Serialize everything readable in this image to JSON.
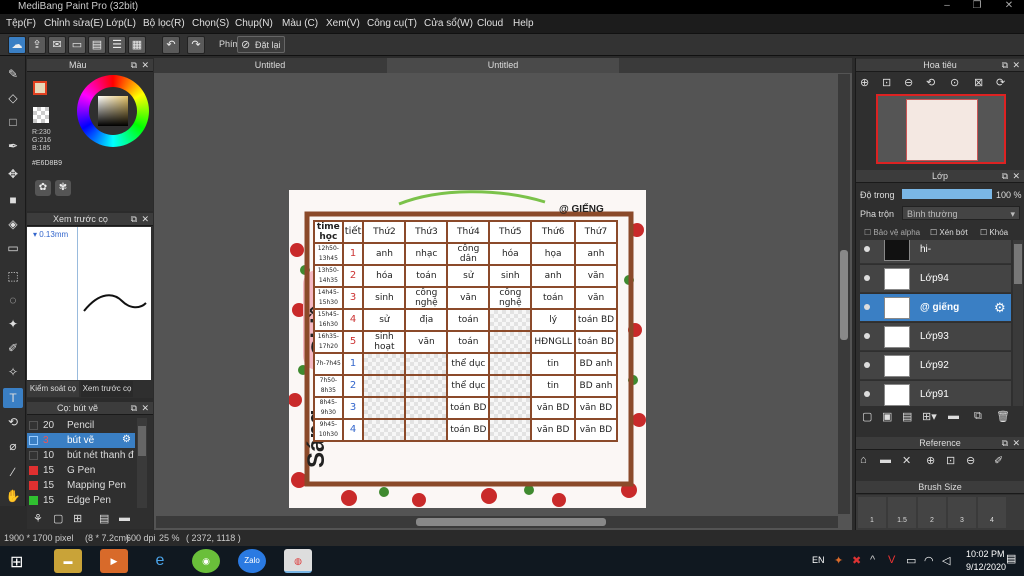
{
  "window": {
    "title": "MediBang Paint Pro (32bit)"
  },
  "menu": [
    "Tệp(F)",
    "Chỉnh sửa(E)",
    "Lớp(L)",
    "Bộ lọc(R)",
    "Chọn(S)",
    "Chụp(N)",
    "Màu (C)",
    "Xem(V)",
    "Công cụ(T)",
    "Cửa sổ(W)",
    "Cloud",
    "Help"
  ],
  "toolbar": {
    "snap_label": "Phím",
    "reset_label": "Đặt lại"
  },
  "color_panel": {
    "title": "Màu",
    "r": "R:230",
    "g": "G:216",
    "b": "B:185",
    "hex": "#E6D8B9",
    "primary_color": "#E6D8B9"
  },
  "preview_panel": {
    "title": "Xem trước cọ",
    "size": "0.13mm",
    "tab1": "Kiểm soát cọ",
    "tab2": "Xem trước cọ"
  },
  "brush_panel": {
    "title": "Cọ: bút vẽ",
    "items": [
      {
        "size": "20",
        "name": "Pencil",
        "color": "#333333"
      },
      {
        "size": "3",
        "name": "bút vẽ",
        "color": "#3a7fc4"
      },
      {
        "size": "10",
        "name": "bút nét thanh đ",
        "color": "#333333"
      },
      {
        "size": "15",
        "name": "G Pen",
        "color": "#e03030"
      },
      {
        "size": "15",
        "name": "Mapping Pen",
        "color": "#e03030"
      },
      {
        "size": "15",
        "name": "Edge Pen",
        "color": "#30c030"
      }
    ]
  },
  "tabs": [
    "Untitled",
    "Untitled"
  ],
  "document": {
    "signature": "@ GIẾNG",
    "side_top": "Chiều",
    "side_bottom": "Sáng",
    "headers": [
      "time học",
      "tiết",
      "Thứ2",
      "Thứ3",
      "Thứ4",
      "Thứ5",
      "Thứ6",
      "Thứ7"
    ],
    "rows": [
      {
        "time": "12h50-13h45",
        "tiet": "1",
        "cells": [
          "anh",
          "nhạc",
          "công dân",
          "hóa",
          "họa",
          "anh"
        ]
      },
      {
        "time": "13h50-14h35",
        "tiet": "2",
        "cells": [
          "hóa",
          "toán",
          "sử",
          "sinh",
          "anh",
          "văn"
        ]
      },
      {
        "time": "14h45-15h30",
        "tiet": "3",
        "cells": [
          "sinh",
          "công nghệ",
          "văn",
          "công nghệ",
          "toán",
          "văn"
        ]
      },
      {
        "time": "15h45-16h30",
        "tiet": "4",
        "cells": [
          "sử",
          "địa",
          "toán",
          "",
          "lý",
          "toán BD"
        ]
      },
      {
        "time": "16h35-17h20",
        "tiet": "5",
        "cells": [
          "sinh hoạt",
          "văn",
          "toán",
          "",
          "HĐNGLL",
          "toán BD"
        ]
      },
      {
        "time": "7h-7h45",
        "tiet": "1",
        "cells": [
          "",
          "",
          "thể dục",
          "",
          "tin",
          "BD anh"
        ]
      },
      {
        "time": "7h50-8h35",
        "tiet": "2",
        "cells": [
          "",
          "",
          "thể dục",
          "",
          "tin",
          "BD anh"
        ]
      },
      {
        "time": "8h45-9h30",
        "tiet": "3",
        "cells": [
          "",
          "",
          "toán BD",
          "",
          "văn BD",
          "văn BD"
        ]
      },
      {
        "time": "9h45-10h30",
        "tiet": "4",
        "cells": [
          "",
          "",
          "toán BD",
          "",
          "văn BD",
          "văn BD"
        ]
      }
    ]
  },
  "navigator": {
    "title": "Hoa tiêu"
  },
  "layer_panel": {
    "title": "Lớp",
    "opacity_label": "Độ trong",
    "opacity_value": "100 %",
    "opacity_fraction": 1.0,
    "blend_label": "Pha trộn",
    "blend_value": "Bình thường",
    "protect_alpha": "Bảo vệ alpha",
    "clipping": "Xén bớt",
    "lock": "Khóa",
    "layers": [
      {
        "name": "hi-",
        "selected": false
      },
      {
        "name": "Lớp94",
        "selected": false
      },
      {
        "name": "@ giếng",
        "selected": true
      },
      {
        "name": "Lớp93",
        "selected": false
      },
      {
        "name": "Lớp92",
        "selected": false
      },
      {
        "name": "Lớp91",
        "selected": false
      }
    ]
  },
  "reference_panel": {
    "title": "Reference"
  },
  "brushsize_panel": {
    "title": "Brush Size",
    "sizes": [
      "1",
      "1.5",
      "2",
      "3",
      "4"
    ]
  },
  "status": {
    "dimensions": "1900 * 1700 pixel",
    "physical": "(8 * 7.2cm)",
    "dpi": "600 dpi",
    "zoom": "25 %",
    "coords": "( 2372, 1118 )"
  },
  "taskbar": {
    "lang": "EN",
    "time": "10:02 PM",
    "date": "9/12/2020",
    "zalo": "Zalo"
  }
}
